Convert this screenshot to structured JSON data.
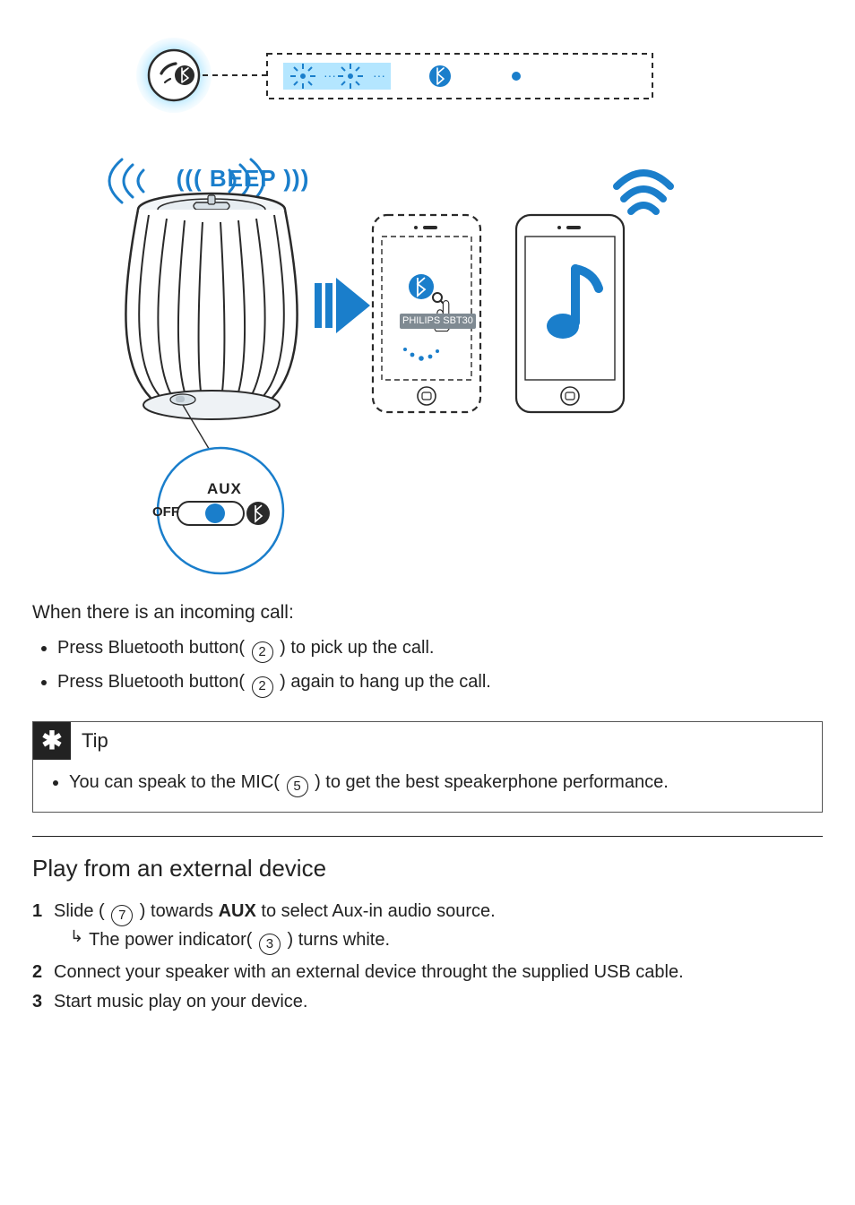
{
  "illustration": {
    "beep": "BEEP",
    "aux": "AUX",
    "off": "OFF",
    "device_name": "PHILIPS SBT30"
  },
  "incoming_call": {
    "intro": "When there is an incoming call:",
    "bullets": [
      {
        "pre": "Press Bluetooth button( ",
        "num": "2",
        "post": " ) to pick up the call."
      },
      {
        "pre": "Press Bluetooth button( ",
        "num": "2",
        "post": " ) again to hang up the call."
      }
    ]
  },
  "tip": {
    "title": "Tip",
    "body": {
      "pre": "You can speak to the MIC( ",
      "num": "5",
      "post": " ) to get the best speakerphone performance."
    }
  },
  "section": {
    "title": "Play from an external device",
    "steps": [
      {
        "pre": "Slide ( ",
        "num": "7",
        "mid": " ) towards ",
        "strong": "AUX",
        "post": " to select Aux-in audio source.",
        "result": {
          "pre": "The power indicator( ",
          "num": "3",
          "post": " ) turns white."
        }
      },
      {
        "text": "Connect your speaker with an external device throught the supplied USB cable."
      },
      {
        "text": "Start music play on your device."
      }
    ]
  }
}
